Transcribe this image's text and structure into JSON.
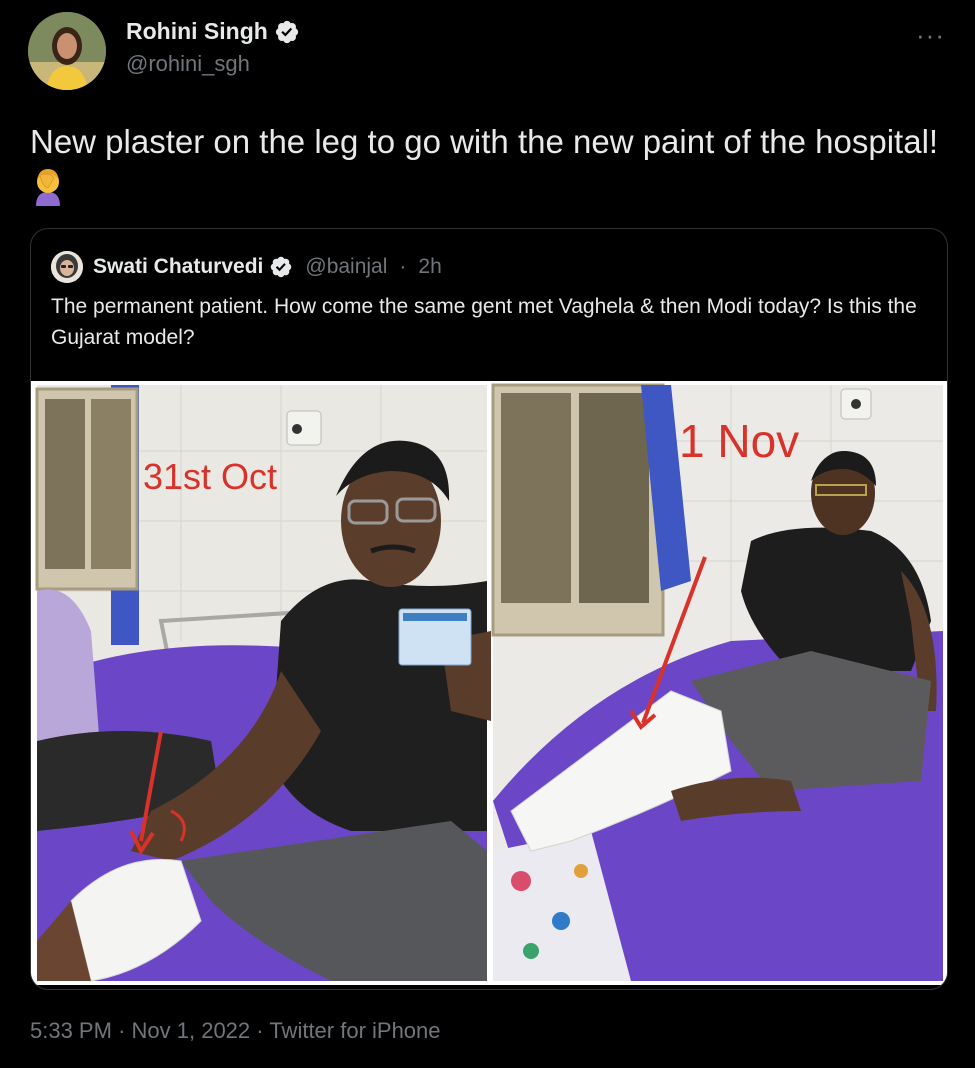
{
  "tweet": {
    "author_name": "Rohini Singh",
    "author_handle": "@rohini_sgh",
    "text": "New plaster on the leg to go with the new paint of the hospital! ",
    "emoji_icon": "woman-facepalming-icon",
    "more_icon": "more-horizontal-icon",
    "timestamp": "5:33 PM",
    "date": "Nov 1, 2022",
    "source": "Twitter for iPhone",
    "separator": "·"
  },
  "quote": {
    "author_name": "Swati Chaturvedi",
    "author_handle": "@bainjal",
    "age": "2h",
    "separator": "·",
    "text": "The permanent patient. How come the same gent met Vaghela & then Modi today? Is this the Gujarat model?",
    "image": {
      "left_label": "31st Oct",
      "right_label": "1 Nov"
    }
  },
  "colors": {
    "background": "#000000",
    "text": "#e7e9ea",
    "muted": "#71767b",
    "border": "#2f3336",
    "verified": "#e7e9ea",
    "annotation_red": "#d8322a",
    "bed_purple": "#6b47c7"
  }
}
